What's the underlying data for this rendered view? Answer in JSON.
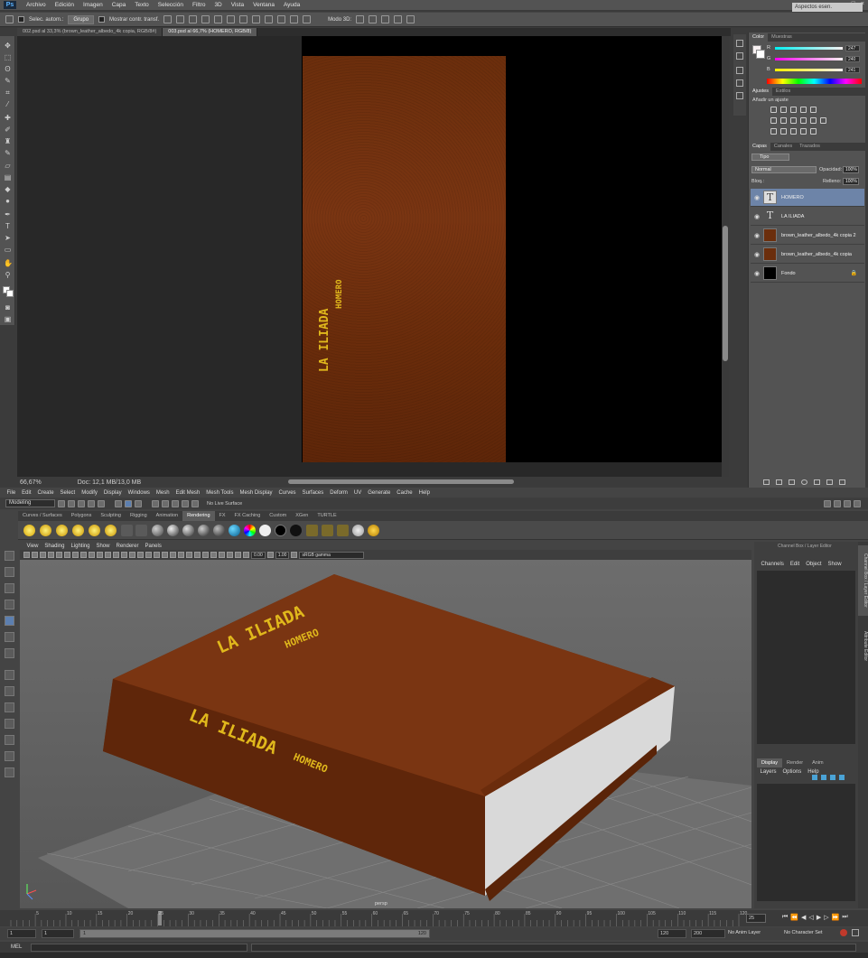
{
  "photoshop": {
    "logo": "Ps",
    "menu": [
      "Archivo",
      "Edición",
      "Imagen",
      "Capa",
      "Texto",
      "Selección",
      "Filtro",
      "3D",
      "Vista",
      "Ventana",
      "Ayuda"
    ],
    "window_controls": [
      "–",
      "□",
      "×"
    ],
    "options": {
      "auto_select_label": "Selec. autom.:",
      "group_value": "Grupo",
      "transform_label": "Mostrar contr. transf.",
      "mode3d_label": "Modo 3D:",
      "workspace": "Aspectos esen."
    },
    "tabs": [
      {
        "label": "002.psd al 33,3% (brown_leather_albedo_4k copia, RGB/8#)",
        "active": false
      },
      {
        "label": "003.psd al 66,7% (HOMERO, RGB/8)",
        "active": true
      }
    ],
    "canvas": {
      "spine_title": "LA ILIADA",
      "spine_author": "HOMERO",
      "leather_color": "#6e2f0d",
      "text_color": "#e0b81c"
    },
    "status": {
      "zoom": "66,67%",
      "doc": "Doc: 12,1 MB/13,0 MB"
    },
    "color_panel": {
      "tabs": [
        "Color",
        "Muestras"
      ],
      "r": "247",
      "g": "240",
      "b": "241"
    },
    "adjust_panel": {
      "tabs": [
        "Ajustes",
        "Estilos"
      ],
      "hint": "Añadir un ajuste"
    },
    "layers_panel": {
      "tabs": [
        "Capas",
        "Canales",
        "Trazados"
      ],
      "kind_filter": "Tipo",
      "blend_mode": "Normal",
      "opacity_label": "Opacidad:",
      "opacity": "100%",
      "lock_label": "Bloq.:",
      "fill_label": "Relleno:",
      "fill": "100%",
      "layers": [
        {
          "name": "HOMERO",
          "kind": "T",
          "selected": true
        },
        {
          "name": "LA ILIADA",
          "kind": "T",
          "selected": false
        },
        {
          "name": "brown_leather_albedo_4k copia 2",
          "kind": "img",
          "selected": false
        },
        {
          "name": "brown_leather_albedo_4k copia",
          "kind": "img",
          "selected": false
        },
        {
          "name": "Fondo",
          "kind": "black",
          "selected": false
        }
      ]
    }
  },
  "maya": {
    "menu": [
      "File",
      "Edit",
      "Create",
      "Select",
      "Modify",
      "Display",
      "Windows",
      "Mesh",
      "Edit Mesh",
      "Mesh Tools",
      "Mesh Display",
      "Curves",
      "Surfaces",
      "Deform",
      "UV",
      "Generate",
      "Cache",
      "Help"
    ],
    "mode": "Modeling",
    "no_live_surface": "No Live Surface",
    "shelf_tabs": [
      {
        "label": "Curves / Surfaces",
        "active": false
      },
      {
        "label": "Polygons",
        "active": false
      },
      {
        "label": "Sculpting",
        "active": false
      },
      {
        "label": "Rigging",
        "active": false
      },
      {
        "label": "Animation",
        "active": false
      },
      {
        "label": "Rendering",
        "active": true
      },
      {
        "label": "FX",
        "active": false
      },
      {
        "label": "FX Caching",
        "active": false
      },
      {
        "label": "Custom",
        "active": false
      },
      {
        "label": "XGen",
        "active": false
      },
      {
        "label": "TURTLE",
        "active": false
      }
    ],
    "panel_menu": [
      "View",
      "Shading",
      "Lighting",
      "Show",
      "Renderer",
      "Panels"
    ],
    "view_fields": {
      "exposure": "0.00",
      "gamma": "1.00",
      "colorspace": "sRGB gamma"
    },
    "viewport": {
      "cover_title": "LA ILIADA",
      "cover_author": "HOMERO",
      "spine_title": "LA ILIADA",
      "spine_author": "HOMERO",
      "camera": "persp"
    },
    "channel_box": {
      "title": "Channel Box / Layer Editor",
      "menu": [
        "Channels",
        "Edit",
        "Object",
        "Show"
      ],
      "disp_tabs": [
        "Display",
        "Render",
        "Anim"
      ],
      "disp_menu": [
        "Layers",
        "Options",
        "Help"
      ]
    },
    "side_tabs": [
      "Channel Box / Layer Editor",
      "Attribute Editor"
    ],
    "timeline": {
      "ticks": [
        "5",
        "10",
        "15",
        "20",
        "25",
        "30",
        "35",
        "40",
        "45",
        "50",
        "55",
        "60",
        "65",
        "70",
        "75",
        "80",
        "85",
        "90",
        "95",
        "100",
        "105",
        "110",
        "115",
        "120"
      ],
      "current": "25",
      "range_start": "1",
      "range_inner_start": "1",
      "range_inner_marker": "1",
      "range_inner_end": "120",
      "range_end": "120",
      "max_end": "200",
      "anim_layer": "No Anim Layer",
      "char_set": "No Character Set"
    },
    "cmd_label": "MEL"
  }
}
